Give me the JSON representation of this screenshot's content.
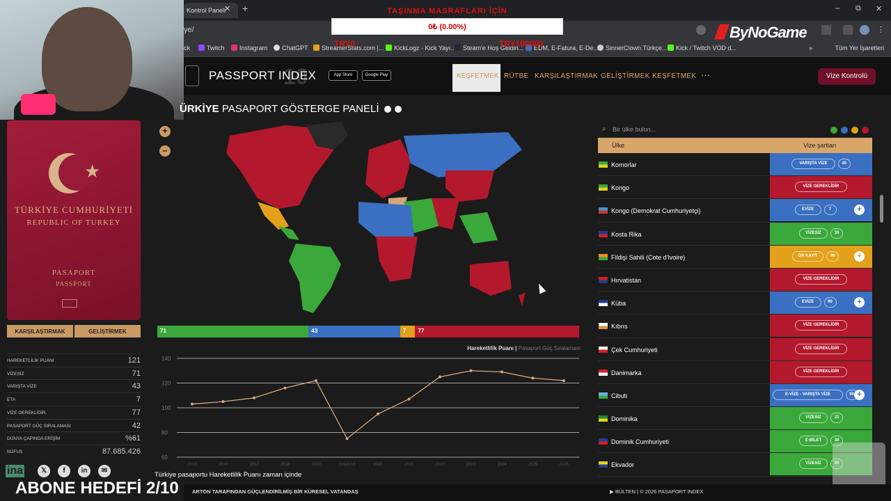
{
  "browser": {
    "tab_title": "Kontrol Paneli",
    "new_tab": "+",
    "address": "ye/",
    "bookmarks": [
      "ck",
      "Twitch",
      "Instagram",
      "ChatGPT",
      "StreamerStats.com |...",
      "KickLogz - Kick Yayı...",
      "Steam'e Hoş Geldin...",
      "EDM, E-Fatura, E-De...",
      "SinnerClown Türkçe...",
      "Kick / Twitch VOD d..."
    ],
    "all_bookmarks": "Tüm Yer İşaretleri",
    "win_min": "–",
    "win_max": "⧉",
    "win_close": "✕",
    "bm_more": "»"
  },
  "overlay": {
    "donation_title": "TAŞINMA MASRAFLARI İÇİN",
    "donation_value": "0₺ (0.00%)",
    "donation_min": "TRY0",
    "donation_max": "TRY100000",
    "sponsor": "ByNoGame",
    "abone": "ABONE HEDEFİ 2/10",
    "ina": "ina"
  },
  "site": {
    "logo": "PASSPORT INDEX",
    "logo_badge": "10",
    "app_store": "App Store",
    "google_play": "Google Play",
    "nav": [
      {
        "label": "KEŞFETMEK",
        "active": true
      },
      {
        "label": "RÜTBE",
        "active": false
      },
      {
        "label": "KARŞILAŞTIRMAK",
        "active": false
      },
      {
        "label": "GELİŞTİRMEK",
        "active": false
      },
      {
        "label": "KEŞFETMEK",
        "active": false
      }
    ],
    "more": "···",
    "cta": "Vize Kontrolü"
  },
  "passport": {
    "line1": "TÜRKİYE CUMHURİYETİ",
    "line2": "REPUBLIC OF TURKEY",
    "line3": "PASAPORT",
    "line4": "PASSPORT",
    "compare": "KARŞILAŞTIRMAK",
    "improve": "GELİŞTİRMEK"
  },
  "stats": [
    {
      "key": "HAREKETLİLİK PUANI",
      "value": "121"
    },
    {
      "key": "VİZESİZ",
      "value": "71"
    },
    {
      "key": "VARIŞTA VİZE",
      "value": "43"
    },
    {
      "key": "ETA",
      "value": "7"
    },
    {
      "key": "VİZE GEREKLİDİR.",
      "value": "77"
    },
    {
      "key": "PASAPORT GÜÇ SIRALAMASI",
      "value": "42"
    },
    {
      "key": "DÜNYA ÇAPINDA ERİŞİM",
      "value": "%61"
    },
    {
      "key": "NÜFUS",
      "value": "87.685.426"
    }
  ],
  "social": [
    "𝕏",
    "f",
    "in",
    "✉"
  ],
  "dashboard": {
    "title_bold": "ÜRKİYE",
    "title_rest": "PASAPORT GÖSTERGE PANELİ",
    "zoom_in": "+",
    "zoom_out": "–"
  },
  "summary": {
    "segments": [
      {
        "label": "71",
        "value": 71,
        "color": "#3aa83a"
      },
      {
        "label": "43",
        "value": 43,
        "color": "#3a6fc1"
      },
      {
        "label": "7",
        "value": 7,
        "color": "#e3a11b"
      },
      {
        "label": "77",
        "value": 77,
        "color": "#b3182c"
      }
    ]
  },
  "chart_header": {
    "active": "Hareketlilik Puanı",
    "separator": "|",
    "inactive": "Pasaport Güç Sıralaması"
  },
  "chart_data": {
    "type": "line",
    "title": "",
    "xlabel": "",
    "ylabel": "",
    "x": [
      "2015",
      "2016",
      "2017",
      "2018",
      "2019",
      "Covid-19",
      "2020",
      "2021",
      "2022",
      "2023",
      "2024",
      "2025",
      "2026"
    ],
    "series": [
      {
        "name": "",
        "values": [
          103,
          105,
          108,
          116,
          122,
          75,
          95,
          107,
          125,
          130,
          129,
          124,
          122
        ]
      }
    ],
    "yticks": [
      60,
      80,
      100,
      120,
      140
    ],
    "ylim": [
      60,
      140
    ],
    "line_color": "#d6a77a",
    "caption": "Türkiye pasaportu Hareketlilik Puanı zaman içinde"
  },
  "country_panel": {
    "search_icon": "search-icon",
    "search_placeholder": "Bir ülke bulun...",
    "filters": [
      "#3aa83a",
      "#3a6fc1",
      "#e3a11b",
      "#b3182c"
    ],
    "col_country": "Ülke",
    "col_req": "Vize şartları",
    "rows": [
      {
        "name": "Komorlar",
        "status": "VARIŞTA VİZE",
        "days": "45",
        "plus": false,
        "color": "#3a6fc1",
        "flag": [
          "#3aa83a",
          "#e3d21b"
        ]
      },
      {
        "name": "Kongo",
        "status": "VİZE GEREKLİDİR",
        "days": "",
        "plus": false,
        "color": "#b3182c",
        "flag": [
          "#3aa83a",
          "#e3d21b"
        ]
      },
      {
        "name": "Kongo (Demokrat Cumhuriyetçi)",
        "status": "EVİZE",
        "days": "7",
        "plus": true,
        "color": "#3a6fc1",
        "flag": [
          "#3a9ad9",
          "#d43030"
        ]
      },
      {
        "name": "Kosta Rika",
        "status": "VİZESİZ",
        "days": "30",
        "plus": false,
        "color": "#3aa83a",
        "flag": [
          "#1f3c8f",
          "#d42020"
        ]
      },
      {
        "name": "Fildişi Sahili (Cote d'Ivoire)",
        "status": "ÖN KAYIT",
        "days": "90",
        "plus": true,
        "color": "#e3a11b",
        "flag": [
          "#f28c1a",
          "#3aa83a"
        ]
      },
      {
        "name": "Hırvatistan",
        "status": "VİZE GEREKLİDİR",
        "days": "",
        "plus": false,
        "color": "#b3182c",
        "flag": [
          "#d42020",
          "#1f3c8f"
        ]
      },
      {
        "name": "Küba",
        "status": "EVİZE",
        "days": "90",
        "plus": true,
        "color": "#3a6fc1",
        "flag": [
          "#1f3c8f",
          "#ffffff"
        ]
      },
      {
        "name": "Kıbrıs",
        "status": "VİZE GEREKLİDİR",
        "days": "",
        "plus": false,
        "color": "#b3182c",
        "flag": [
          "#ffffff",
          "#d9943a"
        ]
      },
      {
        "name": "Çek Cumhuriyeti",
        "status": "VİZE GEREKLİDİR",
        "days": "",
        "plus": false,
        "color": "#b3182c",
        "flag": [
          "#ffffff",
          "#d42020"
        ]
      },
      {
        "name": "Danimarka",
        "status": "VİZE GEREKLİDİR",
        "days": "",
        "plus": false,
        "color": "#b3182c",
        "flag": [
          "#d42020",
          "#ffffff"
        ]
      },
      {
        "name": "Cibuti",
        "status": "E-VİZE - VARIŞTA VİZE",
        "days": "90",
        "plus": true,
        "color": "#3a6fc1",
        "flag": [
          "#6ab0e0",
          "#3aa83a"
        ]
      },
      {
        "name": "Dominika",
        "status": "VİZESİZ",
        "days": "21",
        "plus": false,
        "color": "#3aa83a",
        "flag": [
          "#1f8a3a",
          "#e3d21b"
        ]
      },
      {
        "name": "Dominik Cumhuriyeti",
        "status": "E-BİLET",
        "days": "30",
        "plus": false,
        "color": "#3aa83a",
        "flag": [
          "#1f3c8f",
          "#d42020"
        ]
      },
      {
        "name": "Ekvador",
        "status": "VİZESİZ",
        "days": "90",
        "plus": false,
        "color": "#3aa83a",
        "flag": [
          "#e3d21b",
          "#1f3c8f"
        ]
      }
    ]
  },
  "footer": {
    "left": "ARTON  TARAFINDAN  GÜÇLENDİRİLMİŞ  BİR  KÜRESEL  VATANDAŞ",
    "right": "▶ BÜLTEN  |  © 2026 PASAPORT INDEX"
  }
}
